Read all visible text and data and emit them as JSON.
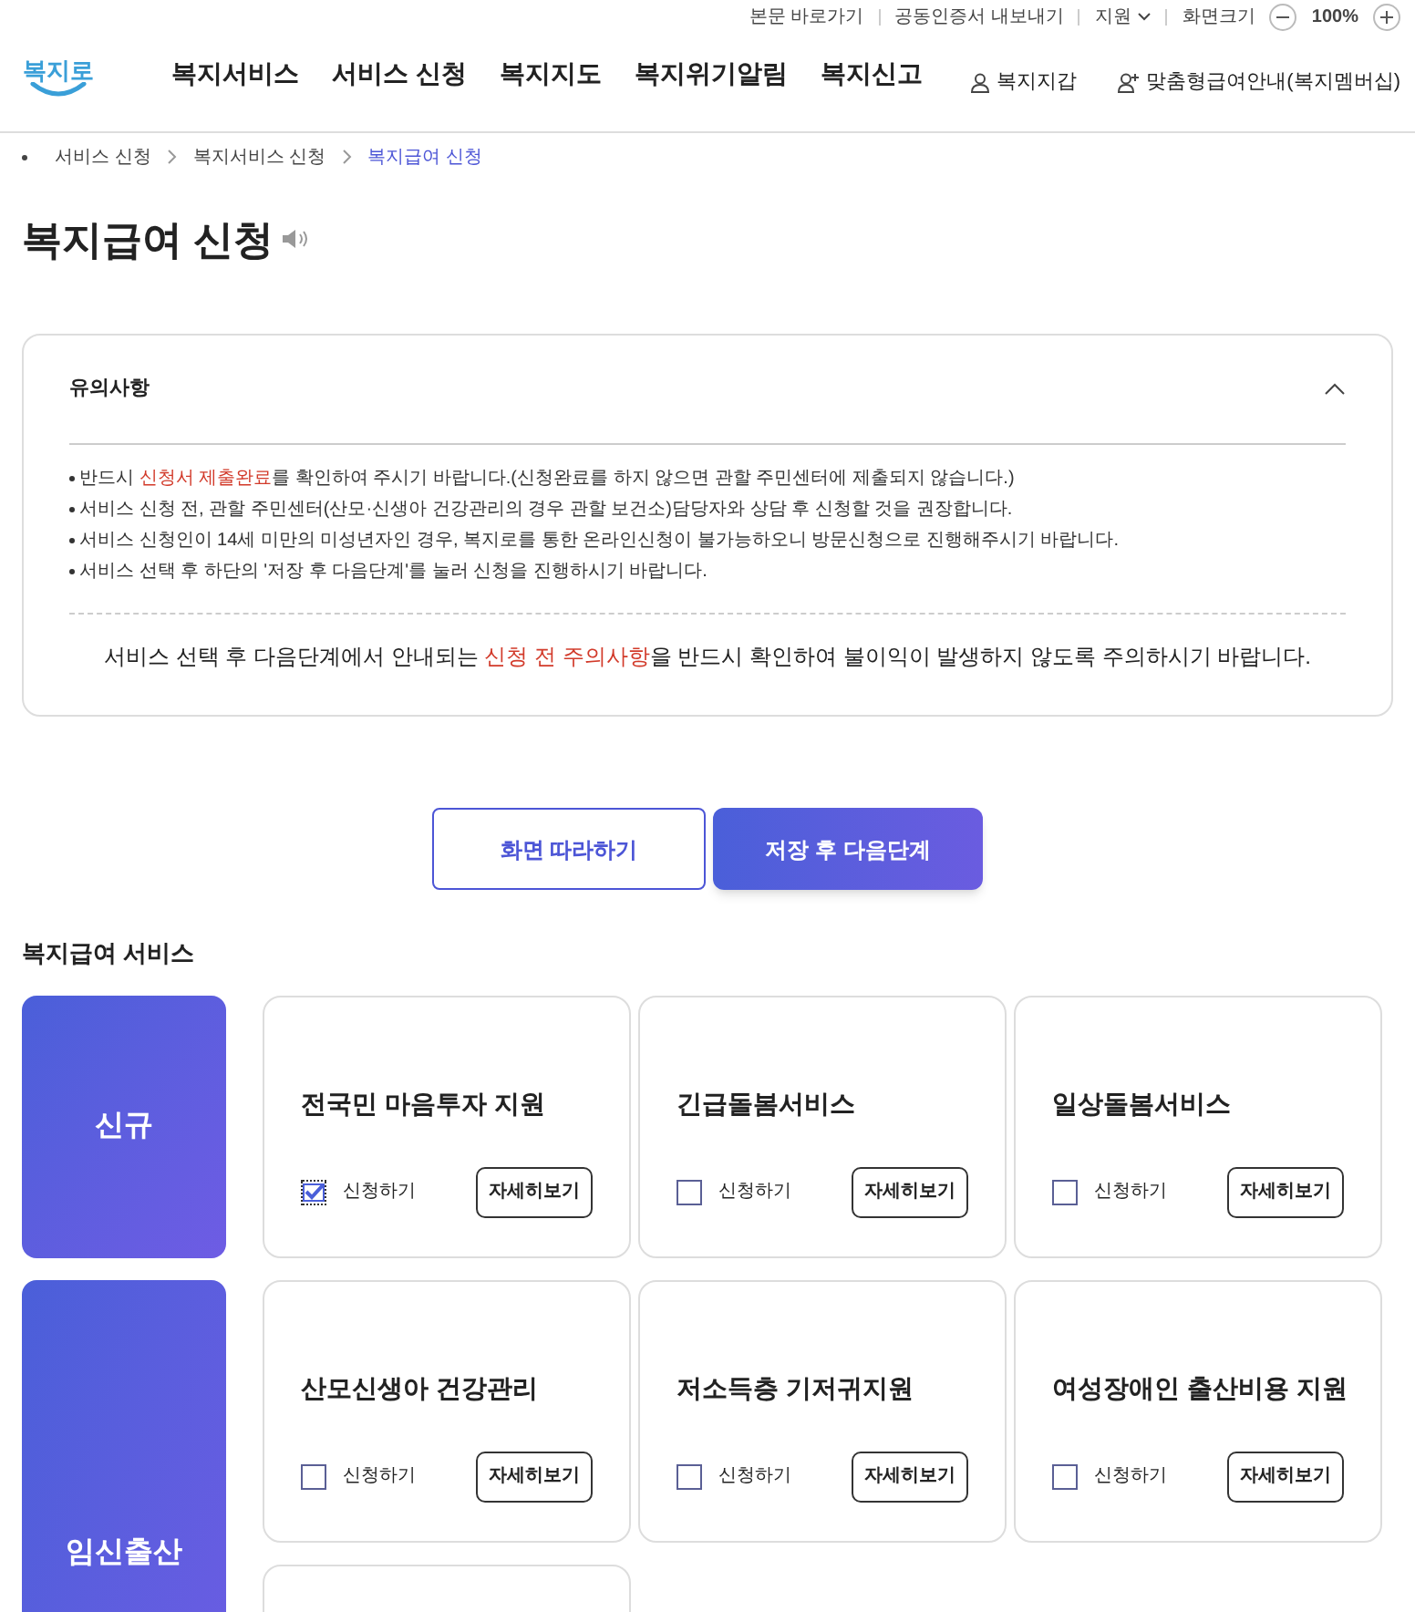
{
  "utility_bar": {
    "links": [
      "본문 바로가기",
      "공동인증서 내보내기"
    ],
    "support": "지원",
    "zoom_label": "화면크기",
    "zoom_value": "100%"
  },
  "header": {
    "logo": "복지로",
    "nav": [
      "복지서비스",
      "서비스 신청",
      "복지지도",
      "복지위기알림",
      "복지신고"
    ],
    "wallet": "복지지갑",
    "membership": "맞춤형급여안내(복지멤버십)"
  },
  "breadcrumb": [
    {
      "label": "서비스 신청",
      "selected": false
    },
    {
      "label": "복지서비스 신청",
      "selected": false
    },
    {
      "label": "복지급여 신청",
      "selected": true
    }
  ],
  "page_title": "복지급여 신청",
  "notice": {
    "title": "유의사항",
    "expanded": true,
    "items": [
      [
        {
          "text": "반드시 "
        },
        {
          "text": "신청서 제출완료",
          "emphasis": true
        },
        {
          "text": "를 확인하여 주시기 바랍니다.(신청완료를 하지 않으면 관할 주민센터에 제출되지 않습니다.)"
        }
      ],
      [
        {
          "text": "서비스 신청 전, 관할 주민센터(산모·신생아 건강관리의 경우 관할 보건소)담당자와 상담 후 신청할 것을 권장합니다."
        }
      ],
      [
        {
          "text": "서비스 신청인이 14세 미만의 미성년자인 경우, 복지로를 통한 온라인신청이 불가능하오니 방문신청으로 진행해주시기 바랍니다."
        }
      ],
      [
        {
          "text": "서비스 선택 후 하단의 '저장 후 다음단계'를 눌러 신청을 진행하시기 바랍니다."
        }
      ]
    ],
    "footer": [
      {
        "text": "서비스 선택 후 다음단계에서 안내되는 "
      },
      {
        "text": "신청 전 주의사항",
        "emphasis": true
      },
      {
        "text": "을 반드시 확인하여 불이익이 발생하지 않도록 주의하시기 바랍니다."
      }
    ]
  },
  "actions": [
    {
      "label": "화면 따라하기",
      "kind": "outline"
    },
    {
      "label": "저장 후 다음단계",
      "kind": "primary"
    }
  ],
  "section_title": "복지급여 서비스",
  "groups": [
    {
      "category": "신규",
      "cards": [
        {
          "kind": "service",
          "title": "전국민 마음투자 지원",
          "checkbox_label": "신청하기",
          "checked": true,
          "detail_button": "자세히보기"
        },
        {
          "kind": "service",
          "title": "긴급돌봄서비스",
          "checkbox_label": "신청하기",
          "checked": false,
          "detail_button": "자세히보기"
        },
        {
          "kind": "service",
          "title": "일상돌봄서비스",
          "checkbox_label": "신청하기",
          "checked": false,
          "detail_button": "자세히보기"
        }
      ]
    },
    {
      "category": "임신출산",
      "cards": [
        {
          "kind": "service",
          "title": "산모신생아 건강관리",
          "checkbox_label": "신청하기",
          "checked": false,
          "detail_button": "자세히보기"
        },
        {
          "kind": "service",
          "title": "저소득층 기저귀지원",
          "checkbox_label": "신청하기",
          "checked": false,
          "detail_button": "자세히보기"
        },
        {
          "kind": "service",
          "title": "여성장애인 출산비용 지원",
          "checkbox_label": "신청하기",
          "checked": false,
          "detail_button": "자세히보기"
        },
        {
          "kind": "cut"
        }
      ]
    }
  ]
}
